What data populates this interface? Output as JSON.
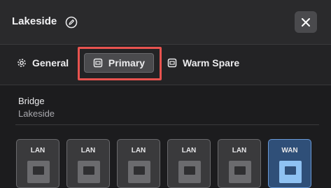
{
  "header": {
    "title": "Lakeside",
    "edit_icon": "edit-circle-icon",
    "close_icon": "close-icon"
  },
  "tabs": [
    {
      "label": "General",
      "icon": "gear-icon",
      "selected": false
    },
    {
      "label": "Primary",
      "icon": "device-icon",
      "selected": true
    },
    {
      "label": "Warm Spare",
      "icon": "device-icon",
      "selected": false
    }
  ],
  "info": {
    "label": "Bridge",
    "value": "Lakeside"
  },
  "ports": [
    {
      "label": "LAN",
      "active": false
    },
    {
      "label": "LAN",
      "active": false
    },
    {
      "label": "LAN",
      "active": false
    },
    {
      "label": "LAN",
      "active": false
    },
    {
      "label": "LAN",
      "active": false
    },
    {
      "label": "WAN",
      "active": true
    }
  ],
  "colors": {
    "highlight_outline": "#e8534f",
    "wan_port": "#2f4f78",
    "wan_socket": "#8fc2f2"
  }
}
